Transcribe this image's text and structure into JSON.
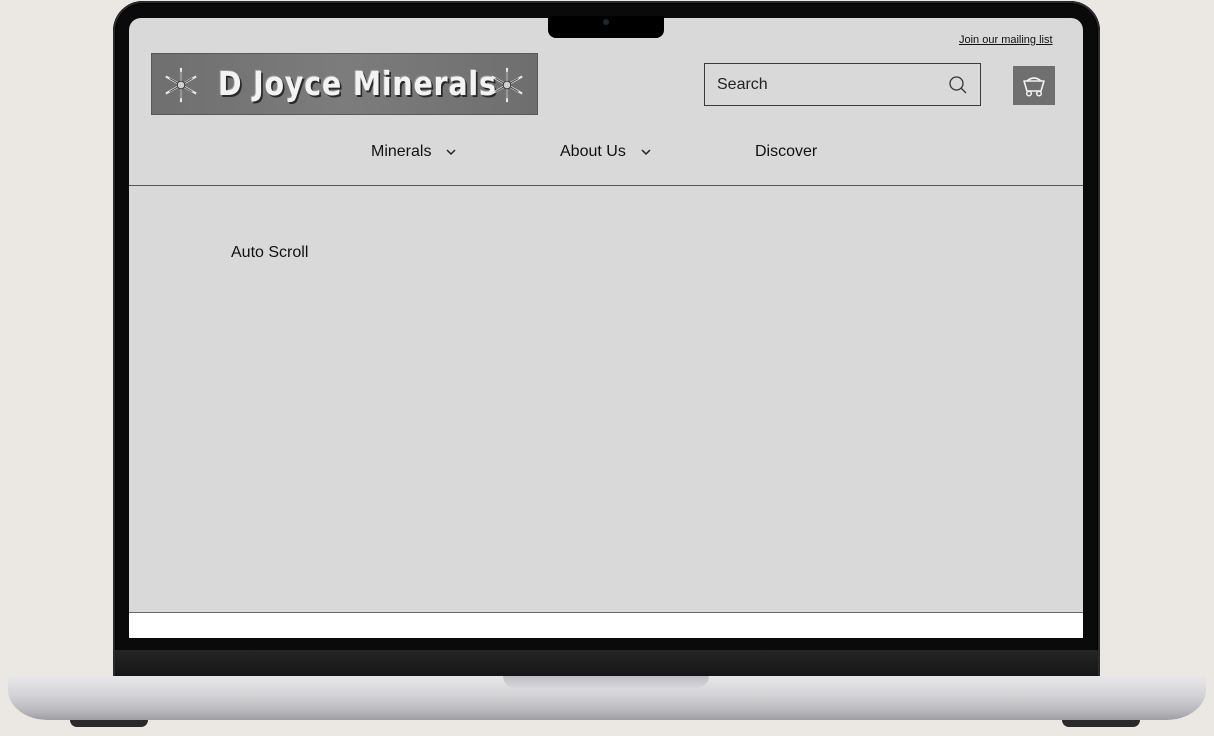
{
  "header": {
    "mailing_link": "Join our mailing list",
    "logo_text": "D Joyce Minerals",
    "logo_icon": "star-crystal-icon",
    "search": {
      "placeholder": "Search",
      "icon": "search-icon"
    },
    "cart_icon": "mine-cart-icon"
  },
  "nav": {
    "items": [
      {
        "label": "Minerals",
        "has_dropdown": true
      },
      {
        "label": "About Us",
        "has_dropdown": true
      },
      {
        "label": "Discover",
        "has_dropdown": false
      }
    ]
  },
  "main": {
    "auto_scroll_label": "Auto Scroll"
  },
  "colors": {
    "page_bg": "#d9d9d9",
    "logo_bg": "#737373",
    "cart_bg": "#6f6f6f",
    "outer_bg": "#ebe7e2"
  }
}
